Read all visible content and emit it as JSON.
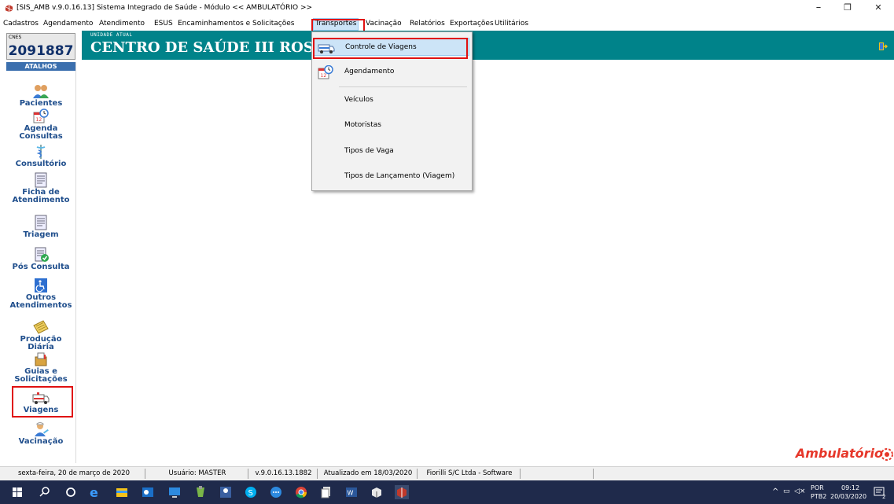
{
  "window": {
    "title": "[SIS_AMB v.9.0.16.13] Sistema Integrado de Saúde - Módulo << AMBULATÓRIO >>",
    "controls": {
      "minimize": "–",
      "maximize": "❐",
      "close": "✕"
    }
  },
  "menubar": {
    "items": [
      "Cadastros",
      "Agendamento",
      "Atendimento",
      "ESUS",
      "Encaminhamentos e Solicitações",
      "Transportes",
      "Vacinação",
      "Relatórios",
      "Exportações",
      "Utilitários"
    ],
    "active": "Transportes"
  },
  "header": {
    "cnes_label": "CNES",
    "cnes_value": "2091887",
    "unit_label": "UNIDADE ATUAL",
    "unit_name": "CENTRO DE SAÚDE III ROSA BORA"
  },
  "sidebar": {
    "title": "ATALHOS",
    "items": [
      {
        "label": "Pacientes",
        "icon": "patients-icon"
      },
      {
        "label": "Agenda\nConsultas",
        "icon": "calendar-clock-icon"
      },
      {
        "label": "Consultório",
        "icon": "caduceus-icon"
      },
      {
        "label": "Ficha de\nAtendimento",
        "icon": "form-icon"
      },
      {
        "label": "Triagem",
        "icon": "form-icon"
      },
      {
        "label": "Pós Consulta",
        "icon": "form-check-icon"
      },
      {
        "label": "Outros\nAtendimentos",
        "icon": "accessibility-icon"
      },
      {
        "label": "Produção\nDiária",
        "icon": "notepad-icon"
      },
      {
        "label": "Guias e\nSolicitações",
        "icon": "mailbox-icon"
      },
      {
        "label": "Viagens",
        "icon": "ambulance-icon"
      },
      {
        "label": "Vacinação",
        "icon": "nurse-icon"
      }
    ]
  },
  "transportes_menu": {
    "items": [
      {
        "label": "Controle de Viagens",
        "icon": "ambulance-icon"
      },
      {
        "label": "Agendamento",
        "icon": "calendar-clock-icon"
      },
      {
        "label": "Veículos"
      },
      {
        "label": "Motoristas"
      },
      {
        "label": "Tipos de Vaga"
      },
      {
        "label": "Tipos de Lançamento (Viagem)"
      }
    ],
    "highlighted": "Controle de Viagens"
  },
  "brand": {
    "text": "Ambulatório"
  },
  "statusbar": {
    "date": "sexta-feira, 20 de março de 2020",
    "user": "Usuário: MASTER",
    "version": "v.9.0.16.13.1882",
    "updated": "Atualizado em 18/03/2020",
    "company": "Fiorilli S/C Ltda - Software"
  },
  "taskbar": {
    "lang": "POR",
    "layout": "PTB2",
    "time": "09:12",
    "date": "20/03/2020",
    "notifications": "2"
  },
  "colors": {
    "header_teal": "#00838a",
    "sidebar_label": "#1f4e8c",
    "highlight": "#cce4f7",
    "annotation_red": "#e01010",
    "brand_red": "#e6372a",
    "taskbar": "#1f2a4b"
  }
}
